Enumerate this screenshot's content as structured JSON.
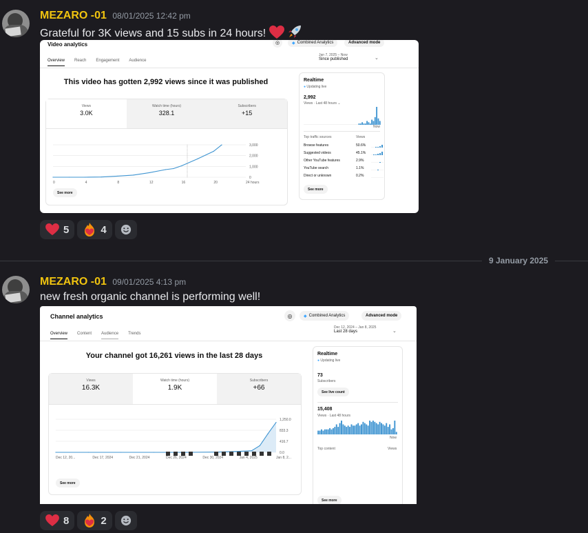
{
  "messages": [
    {
      "username": "MEZARO -01",
      "timestamp": "08/01/2025 12:42 pm",
      "text": "Grateful for 3K views and 15 subs in 24 hours!",
      "reactions": [
        {
          "emoji": "heart",
          "count": "5"
        },
        {
          "emoji": "fire-heart",
          "count": "4"
        }
      ],
      "embed": {
        "title": "Video analytics",
        "combined_label": "Combined Analytics",
        "advanced_label": "Advanced mode",
        "tabs": [
          "Overview",
          "Reach",
          "Engagement",
          "Audience"
        ],
        "date_range": "Jan 7, 2025 – Now",
        "range_label": "Since published",
        "headline": "This video has gotten 2,992 views since it was published",
        "metrics": [
          {
            "label": "Views",
            "value": "3.0K"
          },
          {
            "label": "Watch time (hours)",
            "value": "328.1"
          },
          {
            "label": "Subscribers",
            "value": "+15"
          }
        ],
        "see_more": "See more",
        "realtime": {
          "title": "Realtime",
          "status": "Updating live",
          "value": "2,992",
          "sub": "Views · Last 48 hours",
          "now": "Now",
          "sources_header": "Top traffic sources",
          "views_header": "Views",
          "sources": [
            {
              "name": "Browse features",
              "pct": "50.6%"
            },
            {
              "name": "Suggested videos",
              "pct": "45.1%"
            },
            {
              "name": "Other YouTube features",
              "pct": "2.9%"
            },
            {
              "name": "YouTube search",
              "pct": "1.1%"
            },
            {
              "name": "Direct or unknown",
              "pct": "0.2%"
            }
          ],
          "see_more": "See more"
        }
      }
    },
    {
      "username": "MEZARO -01",
      "timestamp": "09/01/2025 4:13 pm",
      "text": "new fresh organic channel is performing well!",
      "reactions": [
        {
          "emoji": "heart",
          "count": "8"
        },
        {
          "emoji": "fire-heart",
          "count": "2"
        }
      ],
      "embed": {
        "title": "Channel analytics",
        "combined_label": "Combined Analytics",
        "advanced_label": "Advanced mode",
        "tabs": [
          "Overview",
          "Content",
          "Audience",
          "Trends"
        ],
        "date_range": "Dec 12, 2024 – Jan 8, 2025",
        "range_label": "Last 28 days",
        "headline": "Your channel got 16,261 views in the last 28 days",
        "metrics": [
          {
            "label": "Views",
            "value": "16.3K"
          },
          {
            "label": "Watch time (hours)",
            "value": "1.9K"
          },
          {
            "label": "Subscribers",
            "value": "+66"
          }
        ],
        "see_more": "See more",
        "realtime": {
          "title": "Realtime",
          "status": "Updating live",
          "subs_value": "73",
          "subs_label": "Subscribers",
          "live_count": "See live count",
          "value": "15,408",
          "sub": "Views · Last 48 hours",
          "now": "Now",
          "content_header": "Top content",
          "views_header": "Views",
          "see_more": "See more"
        }
      }
    }
  ],
  "date_divider": "9 January 2025",
  "chart_data": [
    {
      "type": "line",
      "x": [
        0,
        2,
        4,
        6,
        8,
        10,
        12,
        14,
        15,
        16,
        18,
        20,
        21
      ],
      "y": [
        0,
        0,
        0,
        20,
        100,
        200,
        420,
        700,
        800,
        1050,
        1700,
        2400,
        2992
      ],
      "xticks": [
        "0",
        "4",
        "8",
        "12",
        "16",
        "20",
        "24 hours"
      ],
      "yticks": [
        "0",
        "1,000",
        "2,000",
        "3,000"
      ],
      "ylim": [
        0,
        3000
      ]
    },
    {
      "type": "line",
      "x": [
        0,
        4,
        8,
        12,
        16,
        20,
        22,
        24,
        25,
        26,
        27
      ],
      "y": [
        0,
        0,
        0,
        0,
        0,
        10,
        30,
        60,
        250,
        700,
        1130
      ],
      "xticks": [
        "Dec 12, 20...",
        "Dec 17, 2024",
        "Dec 21, 2024",
        "Dec 26, 2024",
        "Dec 30, 2024",
        "Jan 4, 2025",
        "Jan 8, 2..."
      ],
      "yticks": [
        "0.0",
        "416.7",
        "833.3",
        "1,250.0"
      ],
      "ylim": [
        0,
        1250
      ]
    }
  ]
}
